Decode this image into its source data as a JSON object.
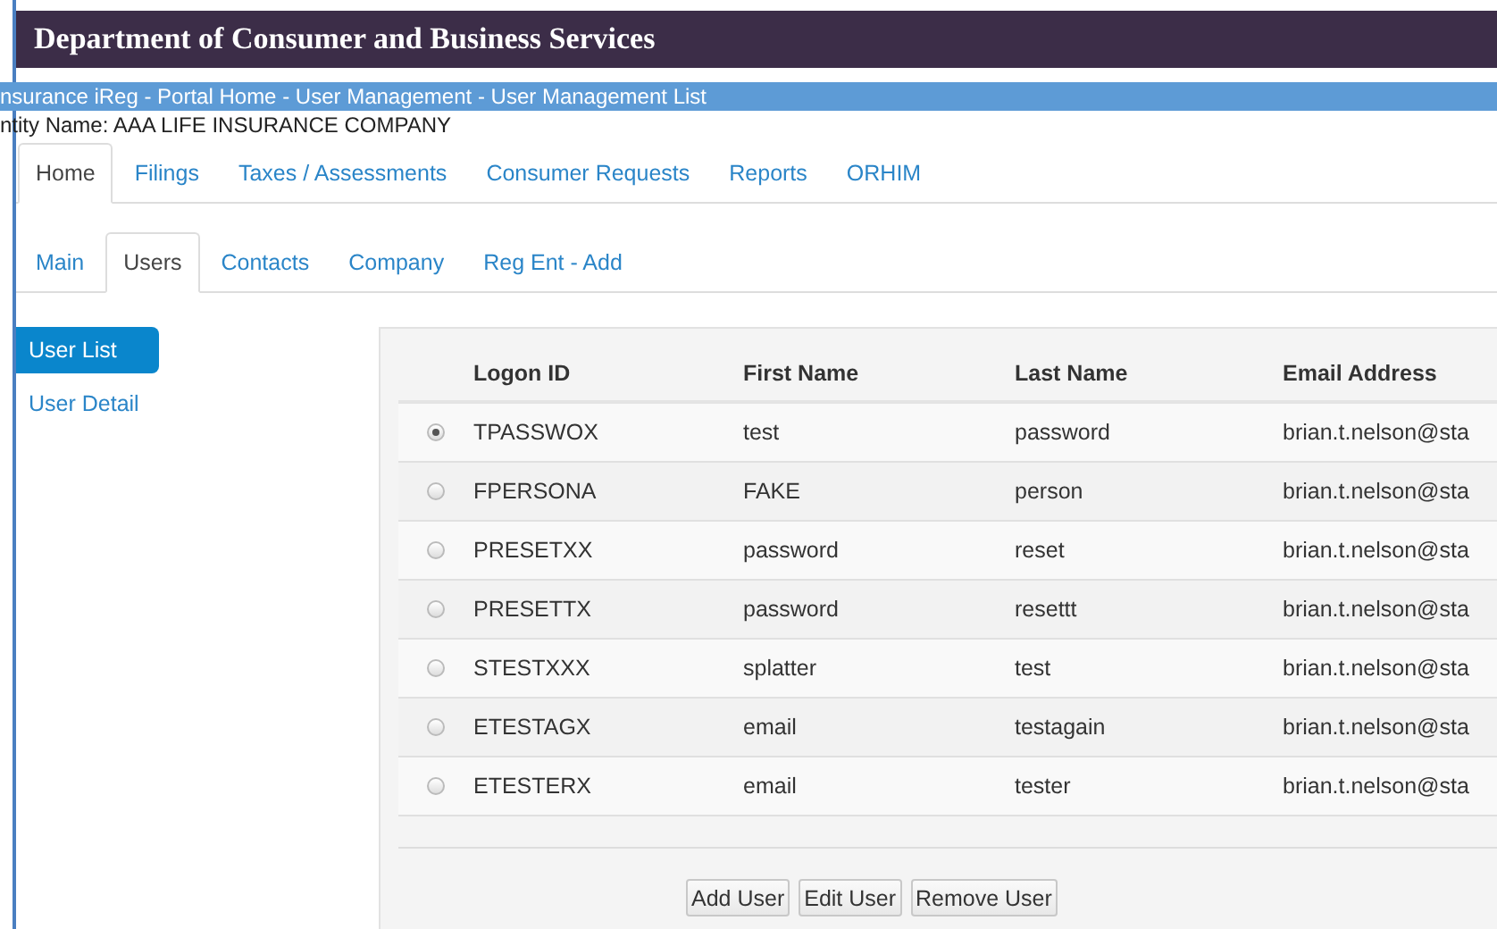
{
  "header": {
    "title": "Department of Consumer and Business Services"
  },
  "breadcrumb": "nsurance iReg - Portal Home - User Management - User Management List",
  "entity_name": "ntity Name: AAA LIFE INSURANCE COMPANY",
  "tabs": [
    {
      "label": "Home",
      "selected": true
    },
    {
      "label": "Filings",
      "selected": false
    },
    {
      "label": "Taxes / Assessments",
      "selected": false
    },
    {
      "label": "Consumer Requests",
      "selected": false
    },
    {
      "label": "Reports",
      "selected": false
    },
    {
      "label": "ORHIM",
      "selected": false
    }
  ],
  "subtabs": [
    {
      "label": "Main",
      "selected": false
    },
    {
      "label": "Users",
      "selected": true
    },
    {
      "label": "Contacts",
      "selected": false
    },
    {
      "label": "Company",
      "selected": false
    },
    {
      "label": "Reg Ent - Add",
      "selected": false
    }
  ],
  "sidebar": {
    "items": [
      {
        "label": "User List",
        "selected": true
      },
      {
        "label": "User Detail",
        "selected": false
      }
    ]
  },
  "table": {
    "columns": [
      "Logon ID",
      "First Name",
      "Last Name",
      "Email Address"
    ],
    "rows": [
      {
        "selected": true,
        "cells": [
          "TPASSWOX",
          "test",
          "password",
          "brian.t.nelson@sta"
        ]
      },
      {
        "selected": false,
        "cells": [
          "FPERSONA",
          "FAKE",
          "person",
          "brian.t.nelson@sta"
        ]
      },
      {
        "selected": false,
        "cells": [
          "PRESETXX",
          "password",
          "reset",
          "brian.t.nelson@sta"
        ]
      },
      {
        "selected": false,
        "cells": [
          "PRESETTX",
          "password",
          "resettt",
          "brian.t.nelson@sta"
        ]
      },
      {
        "selected": false,
        "cells": [
          "STESTXXX",
          "splatter",
          "test",
          "brian.t.nelson@sta"
        ]
      },
      {
        "selected": false,
        "cells": [
          "ETESTAGX",
          "email",
          "testagain",
          "brian.t.nelson@sta"
        ]
      },
      {
        "selected": false,
        "cells": [
          "ETESTERX",
          "email",
          "tester",
          "brian.t.nelson@sta"
        ]
      }
    ]
  },
  "buttons": [
    "Add User",
    "Edit User",
    "Remove User"
  ]
}
